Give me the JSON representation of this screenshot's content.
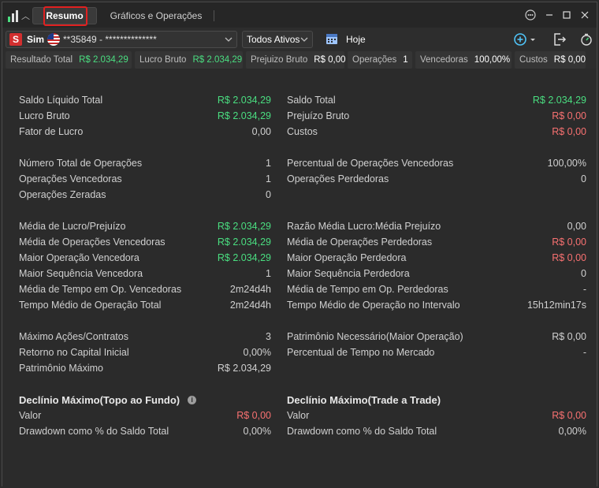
{
  "tabs": [
    {
      "label": "Resumo"
    },
    {
      "label": "Gráficos e Operações"
    }
  ],
  "toolbar": {
    "account_badge": "S",
    "account_mode": "Sim",
    "account_number": "**35849 - **************",
    "assets_filter": "Todos Ativos",
    "period": "Hoje"
  },
  "stats_bar": [
    {
      "label": "Resultado Total",
      "value": "R$ 2.034,29"
    },
    {
      "label": "Lucro Bruto",
      "value": "R$ 2.034,29"
    },
    {
      "label": "Prejuizo Bruto",
      "value": "R$ 0,00"
    },
    {
      "label": "Operações",
      "value": "1"
    },
    {
      "label": "Vencedoras",
      "value": "100,00%"
    },
    {
      "label": "Custos",
      "value": "R$ 0,00"
    }
  ],
  "left": {
    "g1": [
      {
        "k": "Saldo Líquido Total",
        "v": "R$ 2.034,29"
      },
      {
        "k": "Lucro Bruto",
        "v": "R$ 2.034,29"
      },
      {
        "k": "Fator de Lucro",
        "v": "0,00"
      }
    ],
    "g2": [
      {
        "k": "Número Total de Operações",
        "v": "1"
      },
      {
        "k": "Operações Vencedoras",
        "v": "1"
      },
      {
        "k": "Operações Zeradas",
        "v": "0"
      }
    ],
    "g3": [
      {
        "k": "Média de Lucro/Prejuízo",
        "v": "R$ 2.034,29"
      },
      {
        "k": "Média de Operações Vencedoras",
        "v": "R$ 2.034,29"
      },
      {
        "k": "Maior Operação Vencedora",
        "v": "R$ 2.034,29"
      },
      {
        "k": "Maior Sequência Vencedora",
        "v": "1"
      },
      {
        "k": "Média de Tempo em Op. Vencedoras",
        "v": "2m24d4h"
      },
      {
        "k": "Tempo Médio de Operação Total",
        "v": "2m24d4h"
      }
    ],
    "g4": [
      {
        "k": "Máximo Ações/Contratos",
        "v": "3"
      },
      {
        "k": "Retorno no Capital Inicial",
        "v": "0,00%"
      },
      {
        "k": "Patrimônio Máximo",
        "v": "R$ 2.034,29"
      }
    ],
    "drawdown_title": "Declínio Máximo(Topo ao Fundo)",
    "g5": [
      {
        "k": "Valor",
        "v": "R$ 0,00"
      },
      {
        "k": "Drawdown como % do Saldo Total",
        "v": "0,00%"
      }
    ]
  },
  "right": {
    "g1": [
      {
        "k": "Saldo Total",
        "v": "R$ 2.034,29"
      },
      {
        "k": "Prejuízo Bruto",
        "v": "R$ 0,00"
      },
      {
        "k": "Custos",
        "v": "R$ 0,00"
      }
    ],
    "g2": [
      {
        "k": "Percentual de Operações Vencedoras",
        "v": "100,00%"
      },
      {
        "k": "Operações Perdedoras",
        "v": "0"
      }
    ],
    "g3": [
      {
        "k": "Razão Média Lucro:Média Prejuízo",
        "v": "0,00"
      },
      {
        "k": "Média de Operações Perdedoras",
        "v": "R$ 0,00"
      },
      {
        "k": "Maior Operação Perdedora",
        "v": "R$ 0,00"
      },
      {
        "k": "Maior Sequência Perdedora",
        "v": "0"
      },
      {
        "k": "Média de Tempo em Op. Perdedoras",
        "v": "-"
      },
      {
        "k": "Tempo Médio de Operação no Intervalo",
        "v": "15h12min17s"
      }
    ],
    "g4": [
      {
        "k": "Patrimônio Necessário(Maior Operação)",
        "v": "R$ 0,00"
      },
      {
        "k": "Percentual de Tempo no Mercado",
        "v": "-"
      }
    ],
    "drawdown_title": "Declínio Máximo(Trade a Trade)",
    "g5": [
      {
        "k": "Valor",
        "v": "R$ 0,00"
      },
      {
        "k": "Drawdown como % do Saldo Total",
        "v": "0,00%"
      }
    ]
  },
  "colors": {
    "positive": "#4ade80",
    "negative": "#f87171",
    "highlight": "#e02020"
  }
}
